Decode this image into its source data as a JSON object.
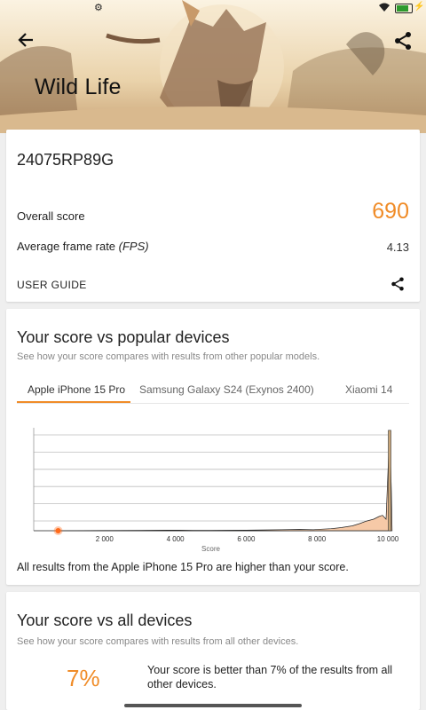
{
  "header": {
    "title": "Wild Life",
    "back_icon": "arrow-left-icon",
    "share_icon": "share-icon"
  },
  "result": {
    "device": "24075RP89G",
    "overall_label": "Overall score",
    "overall_value": "690",
    "fps_label": "Average frame rate ",
    "fps_unit": "(FPS)",
    "fps_value": "4.13",
    "guide_label": "USER GUIDE"
  },
  "popular": {
    "title": "Your score vs popular devices",
    "subtitle": "See how your score compares with results from other popular models.",
    "tabs": [
      {
        "label": "Apple iPhone 15 Pro",
        "active": true
      },
      {
        "label": "Samsung Galaxy S24 (Exynos 2400)",
        "active": false
      },
      {
        "label": "Xiaomi 14",
        "active": false
      }
    ],
    "note": "All results from the Apple iPhone 15 Pro are higher than your score."
  },
  "chart_data": {
    "type": "area",
    "xlabel": "Score",
    "ylabel": "",
    "xlim": [
      0,
      10000
    ],
    "ticks": [
      2000,
      4000,
      6000,
      8000,
      10000
    ],
    "tick_labels": [
      "2 000",
      "4 000",
      "6 000",
      "8 000",
      "10 000"
    ],
    "your_score": 690,
    "series": [
      {
        "x": [
          700,
          2000,
          3000,
          3800,
          4100,
          4500,
          5000,
          6000,
          6500,
          7000,
          7500,
          7900,
          8100,
          8400,
          8700,
          9000,
          9200,
          9400,
          9600,
          9750,
          9850,
          9950,
          10050,
          10100,
          10120
        ],
        "y": [
          0,
          0.2,
          0.3,
          0.5,
          0.5,
          0.3,
          0.3,
          0.4,
          0.6,
          0.8,
          1.0,
          0.8,
          1.2,
          1.6,
          2.5,
          3.8,
          5.5,
          7.5,
          9.0,
          11.0,
          12.0,
          9.0,
          78.0,
          30.0,
          0
        ]
      }
    ],
    "colors": {
      "fill": "#f6c9a7",
      "line": "#222222",
      "marker": "#ff6a1a",
      "spike": "#c9a679"
    }
  },
  "all": {
    "title": "Your score vs all devices",
    "subtitle": "See how your score compares with results from all other devices.",
    "percent": "7%",
    "text": "Your score is better than 7% of the results from all other devices."
  }
}
